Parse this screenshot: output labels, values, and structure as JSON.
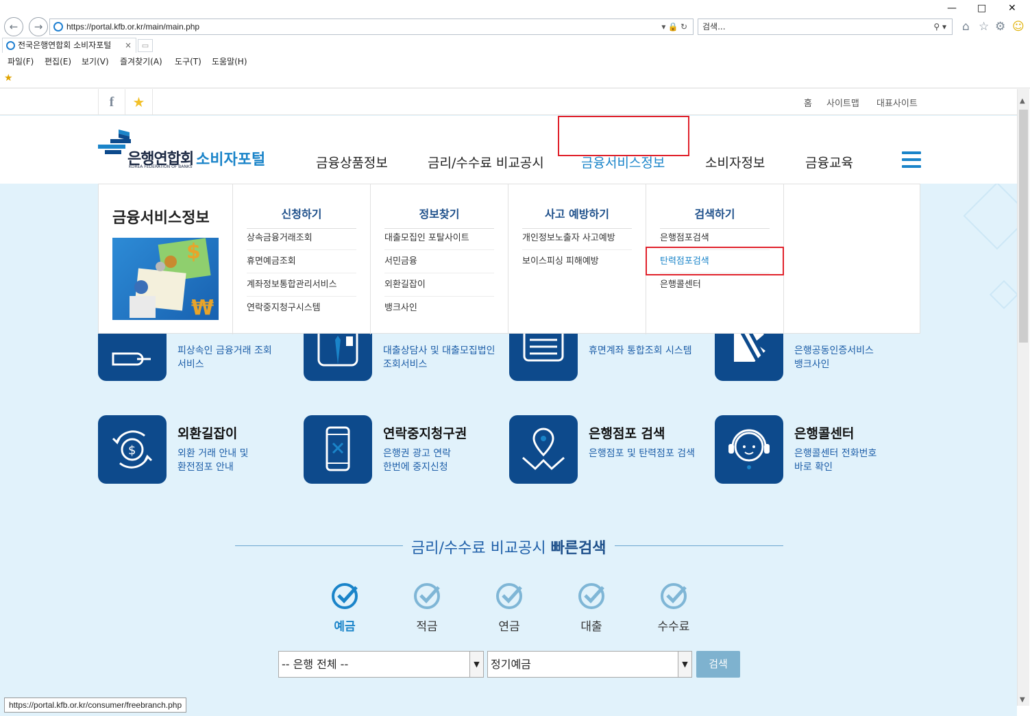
{
  "browser": {
    "url": "https://portal.kfb.or.kr/main/main.php",
    "search_placeholder": "검색...",
    "tab_title": "전국은행연합회 소비자포털",
    "menu": [
      "파일(F)",
      "편집(E)",
      "보기(V)",
      "즐겨찾기(A)",
      "도구(T)",
      "도움말(H)"
    ],
    "status_url": "https://portal.kfb.or.kr/consumer/freebranch.php"
  },
  "site": {
    "top_links": [
      "홈",
      "사이트맵",
      "대표사이트"
    ],
    "logo_text": "은행연합회",
    "logo_sub": "KOREA FEDERATION OF BANKS",
    "logo_portal": "소비자포털",
    "gnb": [
      "금융상품정보",
      "금리/수수료 비교공시",
      "금융서비스정보",
      "소비자정보",
      "금융교육"
    ],
    "gnb_active_index": 2
  },
  "mega": {
    "title": "금융서비스정보",
    "columns": [
      {
        "heading": "신청하기",
        "items": [
          "상속금융거래조회",
          "휴면예금조회",
          "계좌정보통합관리서비스",
          "연락중지청구시스템"
        ]
      },
      {
        "heading": "정보찾기",
        "items": [
          "대출모집인 포탈사이트",
          "서민금융",
          "외환길잡이",
          "뱅크사인"
        ]
      },
      {
        "heading": "사고 예방하기",
        "items": [
          "개인정보노출자 사고예방",
          "보이스피싱 피해예방"
        ]
      },
      {
        "heading": "검색하기",
        "items": [
          "은행점포검색",
          "탄력점포검색",
          "은행콜센터"
        ]
      }
    ],
    "highlighted_item": "탄력점포검색"
  },
  "tiles_row1": [
    {
      "desc1": "피상속인 금융거래 조회",
      "desc2": "서비스"
    },
    {
      "desc1": "대출상담사 및 대출모집법인",
      "desc2": "조회서비스"
    },
    {
      "desc1": "휴면계좌 통합조회 시스템",
      "desc2": ""
    },
    {
      "desc1": "은행공동인증서비스",
      "desc2": "뱅크사인"
    }
  ],
  "tiles_row2": [
    {
      "title": "외환길잡이",
      "desc1": "외환 거래 안내 및",
      "desc2": "환전점포 안내",
      "icon": "exchange-icon"
    },
    {
      "title": "연락중지청구권",
      "desc1": "은행권 광고 연락",
      "desc2": "한번에 중지신청",
      "icon": "phone-block-icon"
    },
    {
      "title": "은행점포 검색",
      "desc1": "은행점포 및 탄력점포 검색",
      "desc2": "",
      "icon": "map-pin-icon"
    },
    {
      "title": "은행콜센터",
      "desc1": "은행콜센터 전화번호",
      "desc2": "바로 확인",
      "icon": "headset-icon"
    }
  ],
  "quick_search": {
    "title_prefix": "금리/수수료 비교공시 ",
    "title_bold": "빠른검색",
    "categories": [
      "예금",
      "적금",
      "연금",
      "대출",
      "수수료"
    ],
    "active_category": "예금",
    "bank_select": "-- 은행 전체 --",
    "product_select": "정기예금",
    "button": "검색"
  },
  "colors": {
    "primary": "#1a84c9",
    "tile": "#0d4a8c",
    "highlight_border": "#e0202a"
  }
}
